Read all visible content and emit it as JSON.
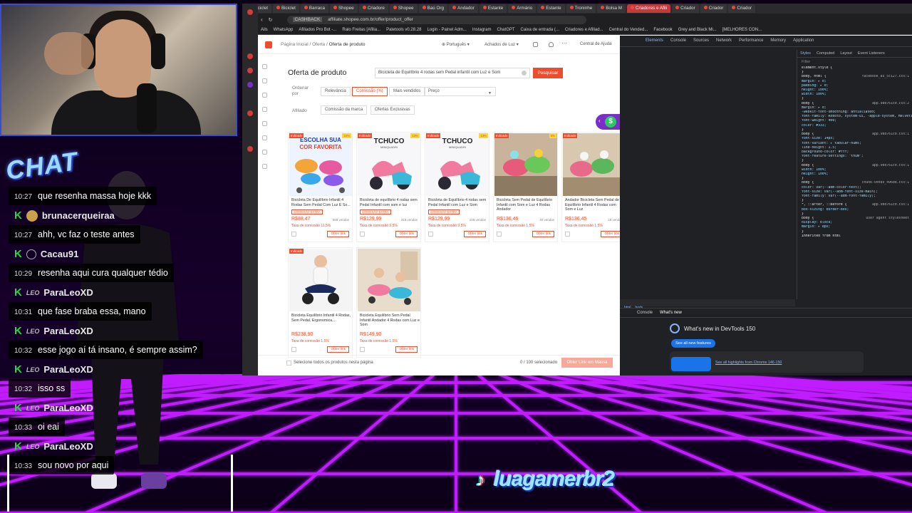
{
  "browser": {
    "tabs": [
      "Biciclet",
      "Biciclet",
      "Barraca",
      "Shopee",
      "Criadore",
      "Shopee",
      "Baú Org",
      "Andador",
      "Estante",
      "Armário",
      "Estante",
      "Troninhe",
      "Bolsa M",
      "Criadores e Afili",
      "Criador",
      "Criador",
      "Criador"
    ],
    "active_tab_index": 13,
    "address_badge": "CASHBACK",
    "address": "affiliate.shopee.com.br/offer/product_offer",
    "bookmarks": [
      "Ails",
      "WhatsApp",
      "Afiliados Pro Bot -...",
      "Ralo Freitas [Afilia...",
      "Paletools v0.28.28",
      "Login - Painel Adm...",
      "Instagram",
      "ChatGPT",
      "Caixa de entrada (...",
      "Criadores e Afiliad...",
      "Central do Vended...",
      "Facebook",
      "Grey and Black Mi...",
      "[MELHORES CON..."
    ]
  },
  "page": {
    "breadcrumb_root": "Página Inicial",
    "breadcrumb_mid": "Oferta",
    "breadcrumb_current": "Oferta de produto",
    "language": "Português",
    "store": "Achados de Luz",
    "help": "Central de Ajuda",
    "title": "Oferta de produto",
    "search_value": "Bicicleta de Equilíbrio 4 rodas sem Pedal infantil com Luz e Som",
    "search_button": "Pesquisar",
    "order_label": "Ordenar por",
    "sort_options": [
      "Relevância",
      "Comissão (%)",
      "Mais vendidos"
    ],
    "sort_active": 1,
    "price_label": "Preço",
    "affiliate_label": "Afiliado",
    "affiliate_options": [
      "Comissão da marca",
      "Ofertas Exclusivas"
    ],
    "fab_symbol": "$",
    "products": [
      {
        "tag": "Indicado",
        "disc": "10%",
        "img": "ESCOLHA SUA COR FAVORITA",
        "name": "Bicicleta De Equilíbrio Infantil 4 Rodas Sem Pedal Com Luz E So...",
        "comm": "COMISSÃO EXTRA",
        "price": "R$88,47",
        "sold": "568 vendas",
        "rate": "Taxa de comissão 11,5%",
        "link": "Obter link"
      },
      {
        "tag": "Indicado",
        "disc": "13%",
        "img": "TCHUCO MINIQUADRI",
        "name": "Bicicleta de equilíbrio 4 rodas sem Pedal Infantil com som e luz",
        "comm": "COMISSÃO EXTRA",
        "price": "R$129,99",
        "sold": "316 vendas",
        "rate": "Taxa de comissão 9,5%",
        "link": "Obter link"
      },
      {
        "tag": "Indicado",
        "disc": "13%",
        "img": "TCHUCO MINIQUADRI",
        "name": "Bicicleta de Equilíbrio 4 rodas sem Pedal Infantil com Luz e Som",
        "comm": "COMISSÃO EXTRA",
        "price": "R$129,99",
        "sold": "156 vendas",
        "rate": "Taxa de comissão 9,5%",
        "link": "Obter link"
      },
      {
        "tag": "Indicado",
        "disc": "5%",
        "img": "",
        "name": "Bicicleta Sem Pedal de Equilíbrio Infantil com Som e Luz 4 Rodas Andador",
        "comm": "",
        "price": "R$136,46",
        "sold": "40 vendas",
        "rate": "Taxa de comissão 1,5%",
        "link": "Obter link"
      },
      {
        "tag": "Indicado",
        "disc": "",
        "img": "",
        "name": "Andador Bicicleta Sem Pedal de Equilíbrio Infantil 4 Rodas com Som e Luz",
        "comm": "",
        "price": "R$136,45",
        "sold": "18 vendas",
        "rate": "Taxa de comissão 1,5%",
        "link": "Obter link"
      },
      {
        "tag": "Indicado",
        "disc": "",
        "img": "",
        "name": "Bicicleta Equilíbrio Infantil 4 Rodas, Sem Pedal, Ergonomica,...",
        "comm": "",
        "price": "R$238,90",
        "sold": "",
        "rate": "Taxa de comissão 1,5%",
        "link": "Obter link"
      },
      {
        "tag": "",
        "disc": "",
        "img": "",
        "name": "Bicicleta Equilíbrio Sem Pedal Infantil Andador 4 Rodas com Luz e Som",
        "comm": "",
        "price": "R$149,90",
        "sold": "",
        "rate": "Taxa de comissão 1,5%",
        "link": "Obter link"
      }
    ],
    "select_all": "Selecione todos os produtos nesta página",
    "selected_count": "0 / 100 selecionado",
    "mass_button": "Obter Link em Massa"
  },
  "devtools": {
    "tabs": [
      "Elements",
      "Console",
      "Sources",
      "Network",
      "Performance",
      "Memory",
      "Application"
    ],
    "styles_tabs": [
      "Styles",
      "Computed",
      "Layout",
      "Event Listeners"
    ],
    "filter_placeholder": "Filter",
    "styles": [
      {
        "t": "element.style {",
        "s": ""
      },
      {
        "t": "}",
        "s": ""
      },
      {
        "t": "body, html {",
        "s": "facebook_au_5c127.css:1"
      },
      {
        "t": "  margin: ▸ 0;",
        "s": ""
      },
      {
        "t": "  padding: ▸ 0;",
        "s": ""
      },
      {
        "t": "  height: 100%;",
        "s": ""
      },
      {
        "t": "  width: 100%;",
        "s": ""
      },
      {
        "t": "}",
        "s": ""
      },
      {
        "t": "body {",
        "s": "app.9bd761c0.css:2"
      },
      {
        "t": "  margin: ▸ 0;",
        "s": ""
      },
      {
        "t": "  -webkit-font-smoothing: antialiased;",
        "s": ""
      },
      {
        "t": "  font-family: Roboto, system-ui, -apple-system, Helvetica Neue, Arial, sans-serif;",
        "s": ""
      },
      {
        "t": "  font-weight: 400;",
        "s": ""
      },
      {
        "t": "  color: #333;",
        "s": ""
      },
      {
        "t": "}",
        "s": ""
      },
      {
        "t": "body {",
        "s": "app.9bd761c0.css:1"
      },
      {
        "t": "  font-size: 14px;",
        "s": ""
      },
      {
        "t": "  font-variant: ▸ tabular-nums;",
        "s": ""
      },
      {
        "t": "  line-height: 1.5;",
        "s": ""
      },
      {
        "t": "  background-color: #fff;",
        "s": ""
      },
      {
        "t": "  font-feature-settings: \"tnum\";",
        "s": ""
      },
      {
        "t": "}",
        "s": ""
      },
      {
        "t": "body {",
        "s": "app.9bd761c0.css:1"
      },
      {
        "t": "  width: 100%;",
        "s": ""
      },
      {
        "t": "  height: 100%;",
        "s": ""
      },
      {
        "t": "}",
        "s": ""
      },
      {
        "t": "body {",
        "s": "chunk-vendo_496dd.css:1"
      },
      {
        "t": "  color: var(--adm-color-text);",
        "s": ""
      },
      {
        "t": "  font-size: var(--adm-font-size-main);",
        "s": ""
      },
      {
        "t": "  font-family: var(--adm-font-family);",
        "s": ""
      },
      {
        "t": "}",
        "s": ""
      },
      {
        "t": "*, ::after, ::before {",
        "s": "app.9bd761c0.css:1"
      },
      {
        "t": "  box-sizing: border-box;",
        "s": ""
      },
      {
        "t": "}",
        "s": ""
      },
      {
        "t": "body {",
        "s": "user agent stylesheet"
      },
      {
        "t": "  display: block;",
        "s": ""
      },
      {
        "t": "  margin: ▸ 8px;",
        "s": ""
      },
      {
        "t": "}",
        "s": ""
      },
      {
        "t": "Inherited from html",
        "s": ""
      }
    ],
    "crumb": [
      "html",
      "body"
    ],
    "drawer_tabs": [
      "Console",
      "What's new"
    ],
    "whatsnew_title": "What's new in DevTools 150",
    "whatsnew_button": "See all new features",
    "whatsnew_link": "See all highlights from Chrome 146-150"
  },
  "chat": {
    "title": "CHAT",
    "messages": [
      {
        "time": "10:27",
        "text": "que resenha massa hoje kkk",
        "user": ""
      },
      {
        "time": "10:27",
        "text": "ahh, vc faz o teste antes",
        "user": "brunacerqueiraa",
        "badge": "avatar"
      },
      {
        "time": "10:29",
        "text": "resenha aqui cura qualquer tédio",
        "user": "Cacau91",
        "badge": "person"
      },
      {
        "time": "10:31",
        "text": "que fase braba essa, mano",
        "user": "ParaLeoXD",
        "badge": "LEO"
      },
      {
        "time": "10:32",
        "text": "esse jogo aí tá insano, é sempre assim?",
        "user": "ParaLeoXD",
        "badge": "LEO"
      },
      {
        "time": "10:32",
        "text": "isso ss",
        "user": "ParaLeoXD",
        "badge": "LEO"
      },
      {
        "time": "10:33",
        "text": "oi eai",
        "user": "ParaLeoXD",
        "badge": "LEO"
      },
      {
        "time": "10:33",
        "text": "sou novo por aqui",
        "user": "ParaLeoXD",
        "badge": "LEO"
      }
    ]
  },
  "social": {
    "handle": "luagamerbr2",
    "icon": "tiktok-icon"
  },
  "colors": {
    "accent": "#ee4d2d",
    "grid": "#c01cff",
    "chat_k": "#2fd34a"
  }
}
